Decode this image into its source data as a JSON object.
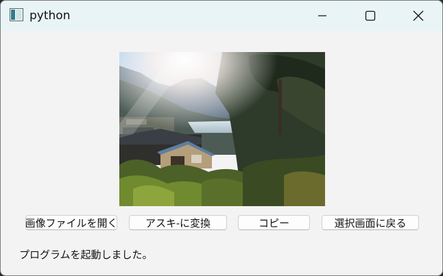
{
  "window": {
    "title": "python",
    "icon": "app-window-icon",
    "controls": {
      "minimize_icon": "minimize-icon",
      "maximize_icon": "maximize-icon",
      "close_icon": "close-icon"
    }
  },
  "image": {
    "subject": "mountain-lake-village-photo"
  },
  "buttons": {
    "open_image": "画像ファイルを開く",
    "convert_ascii": "アスキ-に変換",
    "copy": "コピー",
    "back_to_select": "選択画面に戻る"
  },
  "status": {
    "message": "プログラムを起動しました。"
  },
  "colors": {
    "titlebar": "#e8f4f6",
    "window_bg": "#f3f3f3",
    "button_bg": "#fdfdfd"
  }
}
